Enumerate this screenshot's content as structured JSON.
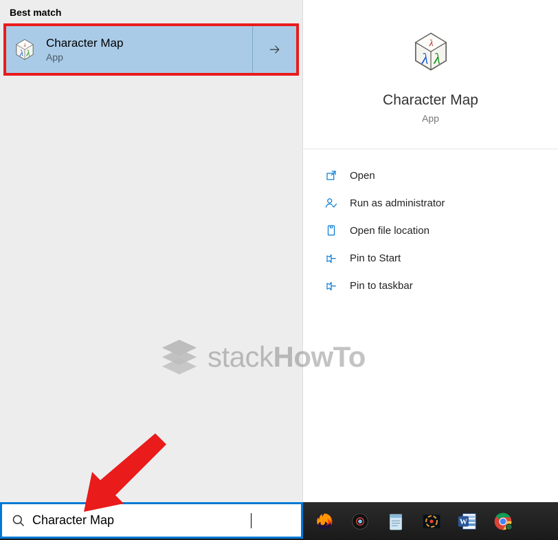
{
  "left": {
    "section_header": "Best match",
    "result": {
      "title": "Character Map",
      "subtitle": "App"
    }
  },
  "right": {
    "title": "Character Map",
    "subtitle": "App",
    "actions": [
      {
        "icon": "open-icon",
        "label": "Open"
      },
      {
        "icon": "admin-icon",
        "label": "Run as administrator"
      },
      {
        "icon": "folder-icon",
        "label": "Open file location"
      },
      {
        "icon": "pin-start-icon",
        "label": "Pin to Start"
      },
      {
        "icon": "pin-taskbar-icon",
        "label": "Pin to taskbar"
      }
    ]
  },
  "watermark": {
    "text_light": "stack",
    "text_bold": "HowTo"
  },
  "search": {
    "value": "Character Map"
  },
  "taskbar": {
    "items": [
      {
        "name": "firefox-icon"
      },
      {
        "name": "media-player-icon"
      },
      {
        "name": "notepad-icon"
      },
      {
        "name": "photoscape-icon"
      },
      {
        "name": "word-icon"
      },
      {
        "name": "chrome-icon"
      }
    ]
  }
}
